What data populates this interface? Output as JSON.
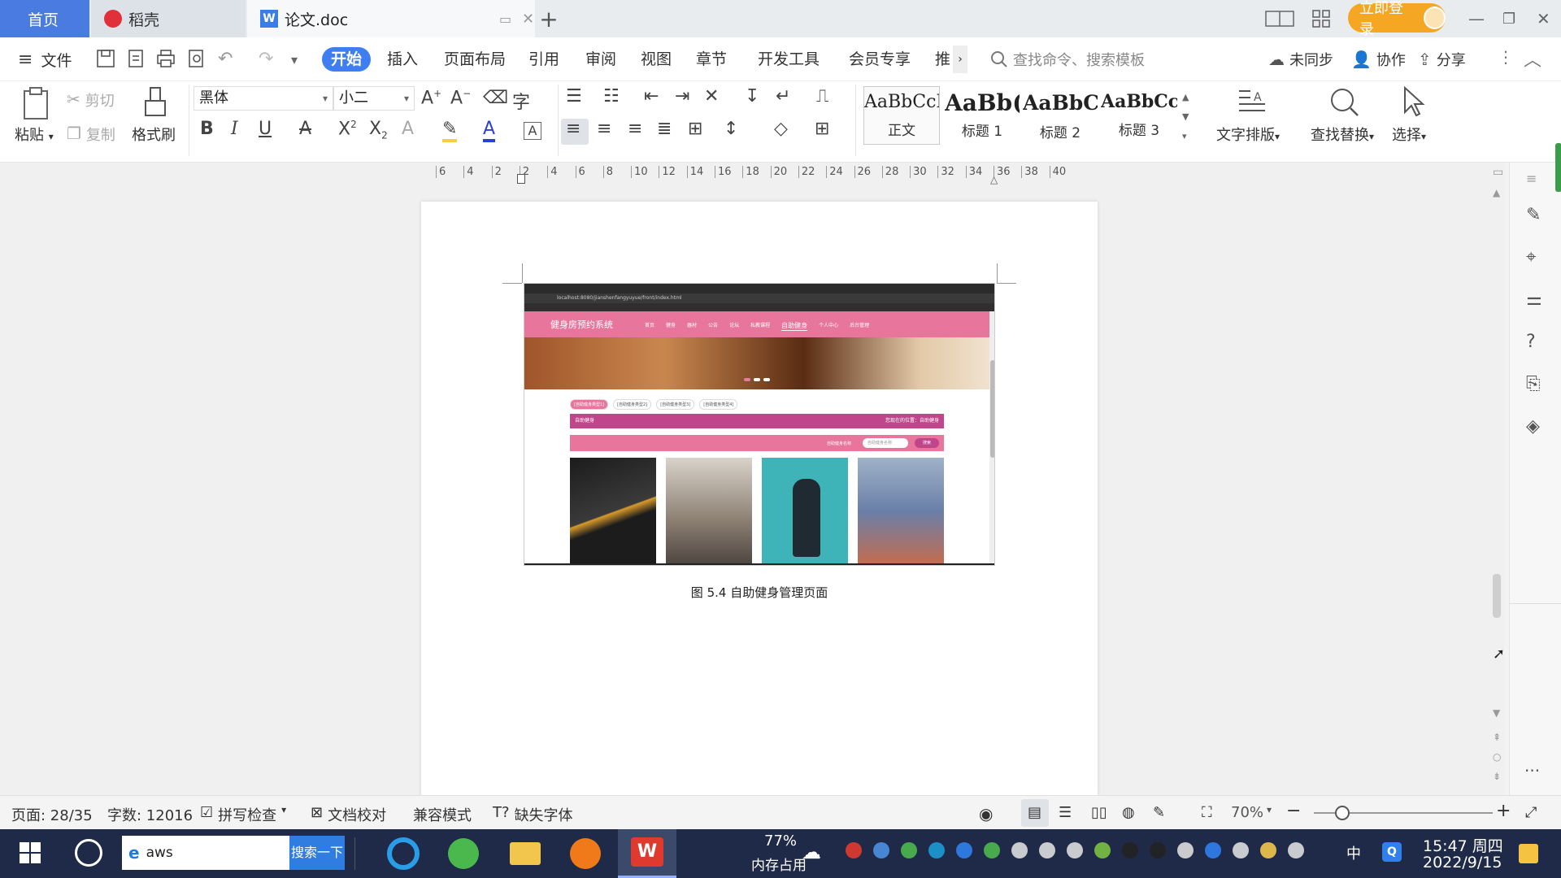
{
  "tabs": {
    "home": "首页",
    "daoke": "稻壳",
    "doc": "论文.doc"
  },
  "window": {
    "login": "立即登录"
  },
  "menu": {
    "file": "文件",
    "items": [
      "开始",
      "插入",
      "页面布局",
      "引用",
      "审阅",
      "视图",
      "章节",
      "开发工具",
      "会员专享",
      "推"
    ],
    "search_placeholder": "查找命令、搜索模板",
    "sync": "未同步",
    "collab": "协作",
    "share": "分享"
  },
  "ribbon": {
    "paste": "粘贴",
    "cut": "剪切",
    "copy": "复制",
    "format_painter": "格式刷",
    "font_name": "黑体",
    "font_size": "小二",
    "styles": [
      {
        "sample": "AaBbCcI",
        "name": "正文"
      },
      {
        "sample": "AaBb(",
        "name": "标题 1"
      },
      {
        "sample": "AaBbC",
        "name": "标题 2"
      },
      {
        "sample": "AaBbCcl",
        "name": "标题 3"
      }
    ],
    "text_layout": "文字排版",
    "find_replace": "查找替换",
    "select": "选择"
  },
  "ruler": [
    "6",
    "4",
    "2",
    "2",
    "4",
    "6",
    "8",
    "10",
    "12",
    "14",
    "16",
    "18",
    "20",
    "22",
    "24",
    "26",
    "28",
    "30",
    "32",
    "34",
    "36",
    "38",
    "40"
  ],
  "document": {
    "caption": "图 5.4  自助健身管理页面",
    "embedded_site": {
      "title": "健身房预约系统",
      "url": "localhost:8080/jianshenfangyuyue/front/index.html",
      "nav": [
        "首页",
        "健身",
        "器材",
        "公告",
        "论坛",
        "私教课程",
        "自助健身",
        "个人中心",
        "后台管理"
      ],
      "active_nav": "自助健身",
      "subtabs": [
        "[自助健身类型1]",
        "[自助健身类型2]",
        "[自助健身类型3]",
        "[自助健身类型4]"
      ],
      "section_title": "自助健身",
      "breadcrumb": "您现在的位置：自助健身",
      "search_label": "自助健身名称",
      "search_placeholder": "自助健身名称",
      "search_button": "搜索"
    }
  },
  "status": {
    "page": "页面: 28/35",
    "words": "字数: 12016",
    "spell": "拼写检查",
    "proof": "文档校对",
    "compat": "兼容模式",
    "missing_font": "缺失字体",
    "zoom": "70%"
  },
  "taskbar": {
    "search_text": "aws",
    "search_button": "搜索一下",
    "memory_pct": "77%",
    "memory_label": "内存占用",
    "ime": "中",
    "time": "15:47 周四",
    "date": "2022/9/15"
  }
}
